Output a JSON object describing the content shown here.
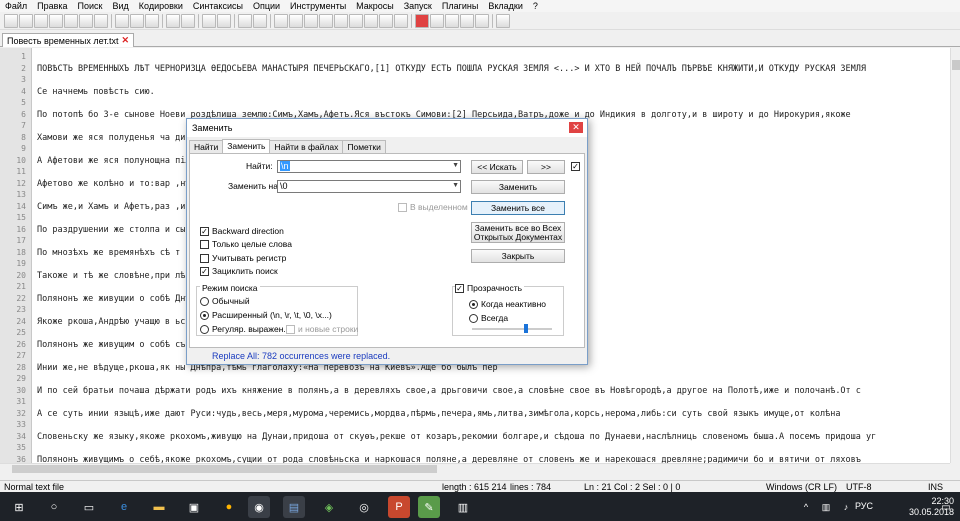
{
  "menu": [
    "Файл",
    "Правка",
    "Поиск",
    "Вид",
    "Кодировки",
    "Синтаксисы",
    "Опции",
    "Инструменты",
    "Макросы",
    "Запуск",
    "Плагины",
    "Вкладки",
    "?"
  ],
  "tab": {
    "filename": "Повесть временных лет.txt",
    "close": "✕"
  },
  "lines": [
    {
      "n": "1",
      "t": ""
    },
    {
      "n": "2",
      "t": "ПОВѢСТЬ ВРЕМЕННЫХЪ ЛѢТ ЧЕРНОРИЗЦА ѲЕДОСЬЕВА МАНАСТЫРЯ ПЕЧЕРЬСКАГО,[1] ОТКУДУ ЕСТЬ ПОШЛА РУСКАЯ ЗЕМЛЯ <...> И ХТО В НЕЙ ПОЧАЛЪ ПѢРВѢЕ КНЯЖИТИ,И ОТКУДУ РУСКАЯ ЗЕМЛЯ"
    },
    {
      "n": "3",
      "t": ""
    },
    {
      "n": "4",
      "t": "Се начнемь повѣсть сию."
    },
    {
      "n": "5",
      "t": ""
    },
    {
      "n": "6",
      "t": "По потопѣ бо 3-е сынове Ноеви роздѣлиша землю:Симъ,Хамъ,Афетъ.Яся въстокъ Симови:[2] Персьида,Ватръ,доже и до Индикия в долготу,и в широту и до Нирокурия,якоже"
    },
    {
      "n": "7",
      "t": ""
    },
    {
      "n": "8",
      "t": "Хамови же яся полуденья ча                                                    дить рѣка ефиопьскаа Чермьна,текущия на въстокъ,Фива,Луви,прилежа"
    },
    {
      "n": "9",
      "t": ""
    },
    {
      "n": "10",
      "t": "А Афетови же яся полунощна                                                    пілагони,Галатия,Кольхысъ,Восприй,меоти,дереви,сарматі,тавриани,С"
    },
    {
      "n": "11",
      "t": ""
    },
    {
      "n": "12",
      "t": "Афетово же колѣно и то:вар                                                    ,нѣмци,корлязи,[16] венедици,фрягове и прочии,присѣдять от запа"
    },
    {
      "n": "13",
      "t": ""
    },
    {
      "n": "14",
      "t": "Симъ же,и Хамъ и Афетъ,раз                                                    ,и живяху кождо въ своей части.И бысть языкъ единъ.И умножившим"
    },
    {
      "n": "15",
      "t": ""
    },
    {
      "n": "16",
      "t": "По раздрушении же столпа и                                                    сынове полуденныя страны.Афетови же сынове западъ прияша и полуно"
    },
    {
      "n": "17",
      "t": ""
    },
    {
      "n": "18",
      "t": "По мнозѣхъ же времянѣхъ сѣ                                                    т тѣхъ словенъ разидошася по земьли и прозвашася имены своими,и"
    },
    {
      "n": "19",
      "t": ""
    },
    {
      "n": "20",
      "t": "Такоже и тѣ же словѣне,при                                                    лѣсѣхъ,а друзии сѣдоша межи Припѣтью и Двиною и наркошася дре"
    },
    {
      "n": "21",
      "t": ""
    },
    {
      "n": "22",
      "t": "Полянонъ же живущии о собѣ                                                    Днѣпра волокъ до Ловоти,и по Ловоти внити в Илмерь озеро вели"
    },
    {
      "n": "23",
      "t": ""
    },
    {
      "n": "24",
      "t": "Якоже ркоша,Андрѣю учащю в                                                    ьское,и въскотѣ поити в Римъ,и приде в устье Днѣпрьское,и отто"
    },
    {
      "n": "25",
      "t": ""
    },
    {
      "n": "26",
      "t": "Полянонъ же живущим о собѣ                                                    съ родом своимъ на своихъ мѣстехъ,володѣюще кождо родомъ свои"
    },
    {
      "n": "27",
      "t": ""
    },
    {
      "n": "28",
      "t": "Инии же,не вѣдуще,ркоша,як                                                    ны Днѣпра,тѣмь глаголаху:«На перевозъ на Киевъ».Аще бо былъ пер"
    },
    {
      "n": "29",
      "t": ""
    },
    {
      "n": "30",
      "t": "И по сей братьи почаша дѣржати родъ ихъ княжение в полянъ,а в деревляхъ свое,а дрьговичи свое,а словѣне свое въ Новѣгородѣ,а другое на Полотѣ,иже и полочанѣ.От с"
    },
    {
      "n": "31",
      "t": ""
    },
    {
      "n": "32",
      "t": "А се суть инии языцѣ,иже дают Руси:чудь,весь,меря,мурома,черемись,мордва,пѣрмь,печера,ямь,литва,зимѣгола,корсь,нерома,либь:си суть свой языкъ имуще,от колѣна"
    },
    {
      "n": "33",
      "t": ""
    },
    {
      "n": "34",
      "t": "Словеньску же языку,якоже ркохомъ,живущю на Дунаи,придоша от скуѳъ,рекше от козаръ,рекомии болгаре,и сѣдоша по Дунаеви,наслѣлниць словеномъ быша.А посемъ придоша уг"
    },
    {
      "n": "35",
      "t": ""
    },
    {
      "n": "36",
      "t": "Полянонъ живущимъ о себѣ,якоже ркохомъ,сущии от рода словѣньска и наркошася поляне,а деревляне от словенъ же и нарекошася древляне;радимичи бо и вятичи от ляховъ"
    }
  ],
  "status": {
    "type": "Normal text file",
    "length": "length : 615 214",
    "lines": "lines : 784",
    "pos": "Ln : 21    Col : 2    Sel : 0 | 0",
    "eol": "Windows (CR LF)",
    "enc": "UTF-8",
    "mode": "INS"
  },
  "dialog": {
    "title": "Заменить",
    "close": "✕",
    "tabs": [
      "Найти",
      "Заменить",
      "Найти в файлах",
      "Пометки"
    ],
    "find_label": "Найти:",
    "find_value": "\\n",
    "replace_label": "Заменить на:",
    "replace_value": "\\0",
    "btn_prev": "<< Искать",
    "btn_next": ">>",
    "btn_replace": "Заменить",
    "in_selection": "В выделенном",
    "btn_replace_all": "Заменить все",
    "btn_replace_all_docs_1": "Заменить все во Всех",
    "btn_replace_all_docs_2": "Открытых Документах",
    "btn_close": "Закрыть",
    "opt_backward": "Backward direction",
    "opt_whole": "Только целые слова",
    "opt_case": "Учитывать регистр",
    "opt_wrap": "Зациклить поиск",
    "mode_title": "Режим поиска",
    "mode_normal": "Обычный",
    "mode_extended": "Расширенный (\\n, \\r, \\t, \\0, \\x...)",
    "mode_regex": "Регуляр. выражен.",
    "newlines": "и новые строки",
    "transparency": "Прозрачность",
    "trans_inactive": "Когда неактивно",
    "trans_always": "Всегда",
    "result": "Replace All: 782 occurrences were replaced."
  },
  "taskbar": {
    "time": "22:30",
    "date": "30.05.2018",
    "lang": "РУС"
  }
}
